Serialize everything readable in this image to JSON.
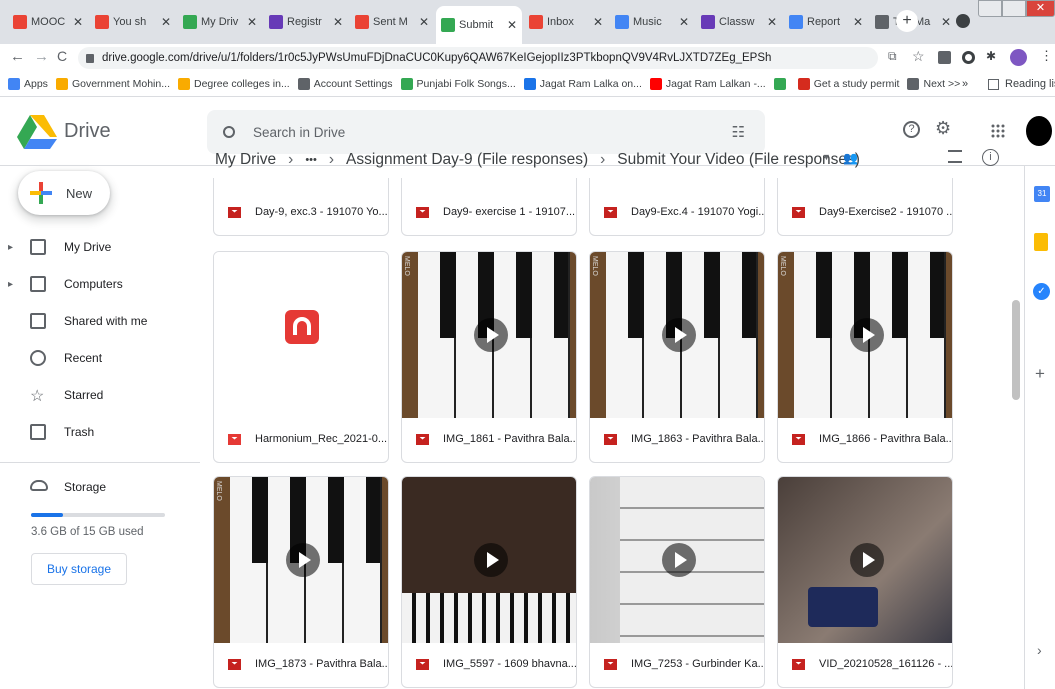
{
  "browser": {
    "tabs": [
      {
        "label": "MOOC",
        "icon": "classroom-icon",
        "color": "#ea4335"
      },
      {
        "label": "You sh",
        "icon": "gmail-icon",
        "color": "#ea4335"
      },
      {
        "label": "My Driv",
        "icon": "drive-icon",
        "color": "#34a853"
      },
      {
        "label": "Registr",
        "icon": "forms-icon",
        "color": "#673ab7"
      },
      {
        "label": "Sent M",
        "icon": "gmail-icon",
        "color": "#ea4335"
      },
      {
        "label": "Submit",
        "icon": "drive-icon",
        "color": "#34a853"
      },
      {
        "label": "Inbox",
        "icon": "gmail-icon",
        "color": "#ea4335"
      },
      {
        "label": "Music",
        "icon": "forms-icon",
        "color": "#4285f4"
      },
      {
        "label": "Classw",
        "icon": "classroom-icon",
        "color": "#673ab7"
      },
      {
        "label": "Report",
        "icon": "forms-icon",
        "color": "#4285f4"
      },
      {
        "label": "The Ma",
        "icon": "page-icon",
        "color": "#5f6368"
      }
    ],
    "active_tab": 5,
    "url": "drive.google.com/drive/u/1/folders/1r0c5JyPWsUmuFDjDnaCUC0Kupy6QAW67KeIGejopIIz3PTkbopnQV9V4RvLJXTD7ZEg_EPSh",
    "bookmarks": [
      {
        "label": "Apps",
        "icon": "apps-grid-icon",
        "color": "#4285f4"
      },
      {
        "label": "Government Mohin...",
        "icon": "bb-icon",
        "color": "#f9ab00"
      },
      {
        "label": "Degree colleges in...",
        "icon": "bb-icon",
        "color": "#f9ab00"
      },
      {
        "label": "Account Settings",
        "icon": "globe-icon",
        "color": "#5f6368"
      },
      {
        "label": "Punjabi Folk Songs...",
        "icon": "music-icon",
        "color": "#34a853"
      },
      {
        "label": "Jagat Ram Lalka on...",
        "icon": "v-icon",
        "color": "#1a73e8"
      },
      {
        "label": "Jagat Ram Lalkan -...",
        "icon": "youtube-icon",
        "color": "#ff0000"
      },
      {
        "label": "",
        "icon": "drive-icon",
        "color": "#34a853"
      },
      {
        "label": "Get a study permit",
        "icon": "canada-icon",
        "color": "#d52b1e"
      },
      {
        "label": "Next >>",
        "icon": "globe-icon",
        "color": "#5f6368"
      }
    ],
    "overflow_label": "»",
    "reading_list": "Reading list"
  },
  "app": {
    "name": "Drive"
  },
  "search": {
    "placeholder": "Search in Drive"
  },
  "sidebar": {
    "new_label": "New",
    "items": [
      {
        "label": "My Drive",
        "icon": "my-drive-icon"
      },
      {
        "label": "Computers",
        "icon": "computers-icon"
      },
      {
        "label": "Shared with me",
        "icon": "shared-icon"
      },
      {
        "label": "Recent",
        "icon": "recent-icon"
      },
      {
        "label": "Starred",
        "icon": "star-icon"
      },
      {
        "label": "Trash",
        "icon": "trash-icon"
      }
    ],
    "storage_label": "Storage",
    "storage_used": "3.6 GB of 15 GB used",
    "storage_fraction": 0.24,
    "buy_storage": "Buy storage"
  },
  "breadcrumb": {
    "items": [
      "My Drive",
      "•••",
      "Assignment Day-9 (File responses)",
      "Submit Your Video (File responses)"
    ],
    "separator": "›"
  },
  "files": {
    "top_row": [
      "Day-9, exc.3 - 191070 Yo...",
      "Day9- exercise 1 - 19107...",
      "Day9-Exc.4 - 191070 Yogi...",
      "Day9-Exercise2 - 191070 ..."
    ],
    "row1": [
      "Harmonium_Rec_2021-0...",
      "IMG_1861 - Pavithra Bala...",
      "IMG_1863 - Pavithra Bala...",
      "IMG_1866 - Pavithra Bala..."
    ],
    "row2": [
      "IMG_1873 - Pavithra Bala...",
      "IMG_5597 - 1609 bhavna...",
      "IMG_7253 - Gurbinder Ka...",
      "VID_20210528_161126 - ..."
    ],
    "thumb_brand": "MELO"
  },
  "colors": {
    "accent": "#1a73e8",
    "video_red": "#c5221f",
    "audio_red": "#e53935"
  }
}
